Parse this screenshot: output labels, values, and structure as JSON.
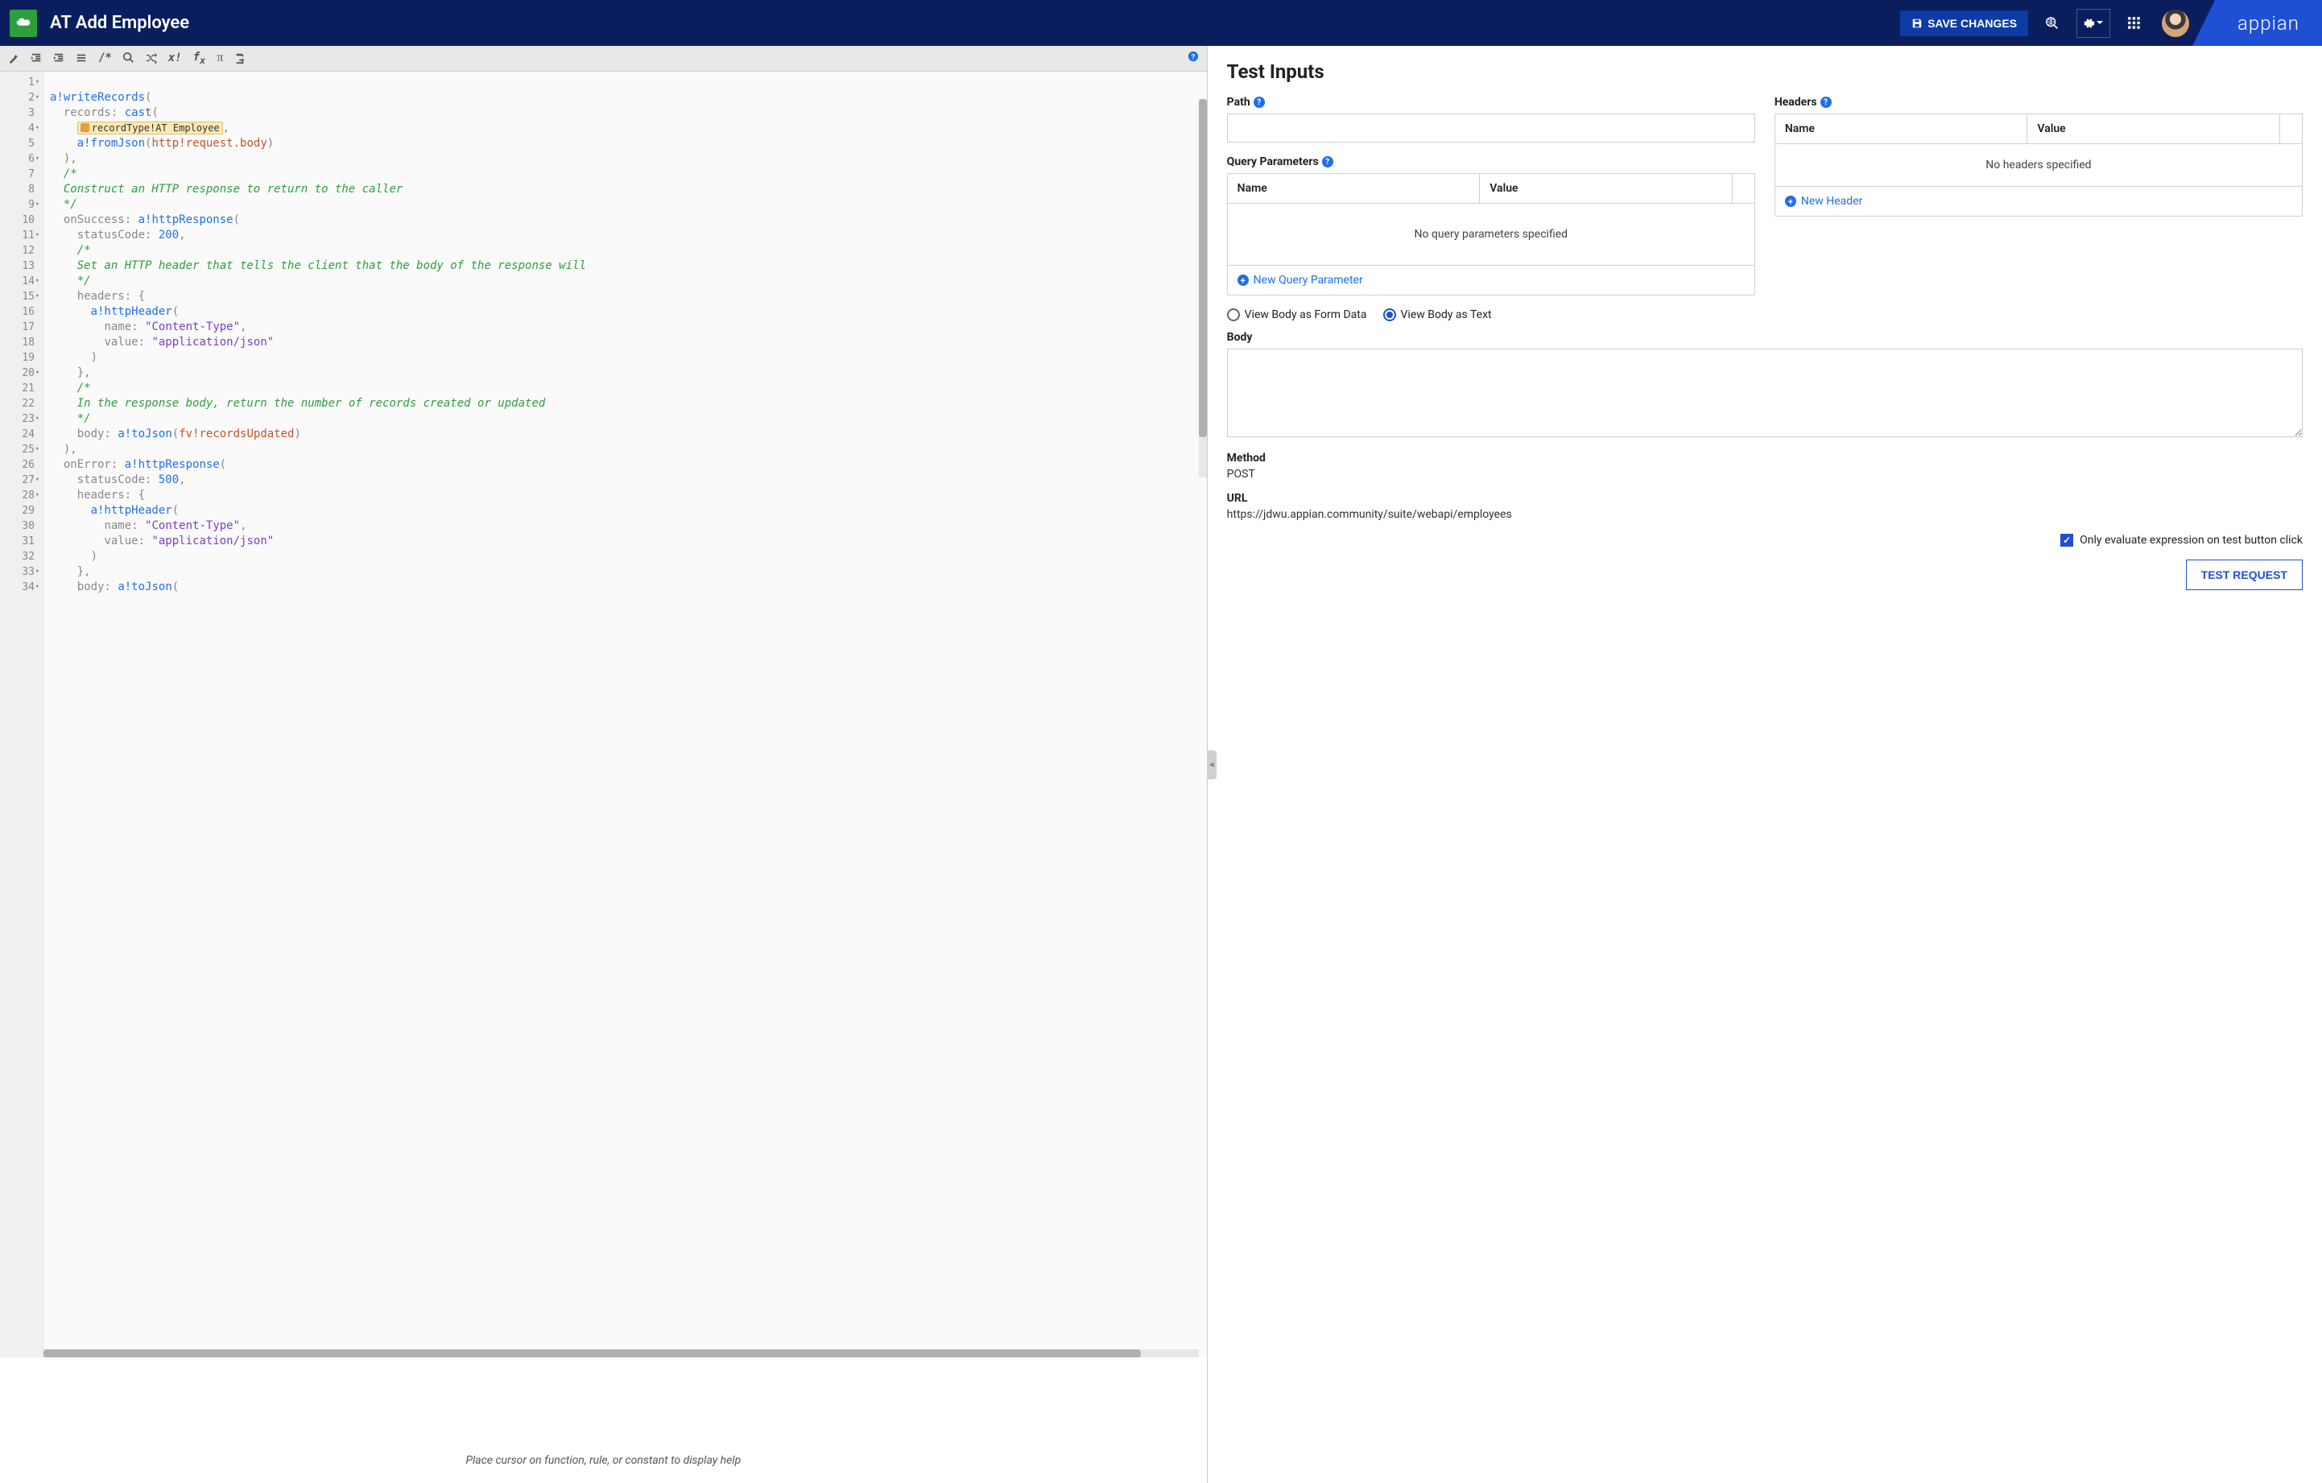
{
  "header": {
    "title": "AT Add Employee",
    "save_label": "SAVE CHANGES",
    "brand": "appian"
  },
  "editor": {
    "help_hint": "Place cursor on function, rule, or constant to display help",
    "lines": [
      {
        "n": "1",
        "arrow": true
      },
      {
        "n": "2",
        "arrow": true
      },
      {
        "n": "3"
      },
      {
        "n": "4",
        "arrow": true
      },
      {
        "n": "5"
      },
      {
        "n": "6",
        "arrow": true
      },
      {
        "n": "7"
      },
      {
        "n": "8"
      },
      {
        "n": "9",
        "arrow": true
      },
      {
        "n": "10"
      },
      {
        "n": "11",
        "arrow": true
      },
      {
        "n": "12"
      },
      {
        "n": "13"
      },
      {
        "n": "14",
        "arrow": true
      },
      {
        "n": "15",
        "arrow": true
      },
      {
        "n": "16"
      },
      {
        "n": "17"
      },
      {
        "n": "18"
      },
      {
        "n": "19"
      },
      {
        "n": "20",
        "arrow": true
      },
      {
        "n": "21"
      },
      {
        "n": "22"
      },
      {
        "n": "23",
        "arrow": true
      },
      {
        "n": "24"
      },
      {
        "n": "25",
        "arrow": true
      },
      {
        "n": "26"
      },
      {
        "n": "27",
        "arrow": true
      },
      {
        "n": "28",
        "arrow": true
      },
      {
        "n": "29"
      },
      {
        "n": "30"
      },
      {
        "n": "31"
      },
      {
        "n": "32"
      },
      {
        "n": "33",
        "arrow": true
      },
      {
        "n": "34",
        "arrow": true
      }
    ],
    "chip_text": "recordType!AT Employee",
    "code": {
      "l1_fn": "a!writeRecords",
      "l1_p": "(",
      "l2_k": "records:",
      "l2_fn": "cast",
      "l2_p": "(",
      "l3_c": ",",
      "l4_fn": "a!fromJson",
      "l4_p1": "(",
      "l4_var": "http!request.body",
      "l4_p2": ")",
      "l5": "),",
      "l6": "/*",
      "l7": "Construct an HTTP response to return to the caller",
      "l8": "*/",
      "l9_k": "onSuccess:",
      "l9_fn": "a!httpResponse",
      "l9_p": "(",
      "l10_k": "statusCode:",
      "l10_n": "200",
      "l10_c": ",",
      "l11": "/*",
      "l12": "Set an HTTP header that tells the client that the body of the response will",
      "l13": "*/",
      "l14_k": "headers:",
      "l14_b": "{",
      "l15_fn": "a!httpHeader",
      "l15_p": "(",
      "l16_k": "name:",
      "l16_s": "\"Content-Type\"",
      "l16_c": ",",
      "l17_k": "value:",
      "l17_s": "\"application/json\"",
      "l18": ")",
      "l19": "},",
      "l20": "/*",
      "l21": "In the response body, return the number of records created or updated",
      "l22": "*/",
      "l23_k": "body:",
      "l23_fn": "a!toJson",
      "l23_p1": "(",
      "l23_var": "fv!recordsUpdated",
      "l23_p2": ")",
      "l24": "),",
      "l25_k": "onError:",
      "l25_fn": "a!httpResponse",
      "l25_p": "(",
      "l26_k": "statusCode:",
      "l26_n": "500",
      "l26_c": ",",
      "l27_k": "headers:",
      "l27_b": "{",
      "l28_fn": "a!httpHeader",
      "l28_p": "(",
      "l29_k": "name:",
      "l29_s": "\"Content-Type\"",
      "l29_c": ",",
      "l30_k": "value:",
      "l30_s": "\"application/json\"",
      "l31": ")",
      "l32": "},",
      "l33_k": "body:",
      "l33_fn": "a!toJson",
      "l33_p": "("
    }
  },
  "test": {
    "title": "Test Inputs",
    "path_label": "Path",
    "query_label": "Query Parameters",
    "headers_label": "Headers",
    "name_col": "Name",
    "value_col": "Value",
    "no_query": "No query parameters specified",
    "no_headers": "No headers specified",
    "new_query": "New Query Parameter",
    "new_header": "New Header",
    "view_form": "View Body as Form Data",
    "view_text": "View Body as Text",
    "body_label": "Body",
    "method_label": "Method",
    "method_value": "POST",
    "url_label": "URL",
    "url_value": "https://jdwu.appian.community/suite/webapi/employees",
    "only_eval": "Only evaluate expression on test button click",
    "test_btn": "TEST REQUEST"
  }
}
